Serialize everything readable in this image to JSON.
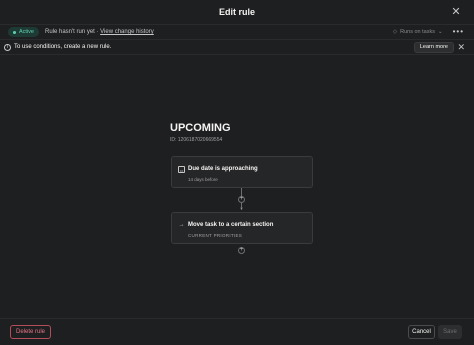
{
  "header": {
    "title": "Edit rule",
    "close_icon": "close-icon"
  },
  "status": {
    "badge": "Active",
    "run_text": "Rule hasn't run yet · ",
    "history_link": "View change history",
    "runs_on": "Runs on tasks",
    "more": "•••"
  },
  "info": {
    "message": "To use conditions, create a new rule.",
    "learn_more": "Learn more"
  },
  "rule": {
    "title": "UPCOMING",
    "id": "ID: 1206187020669554"
  },
  "trigger": {
    "title": "Due date is approaching",
    "subtitle": "14 days before",
    "icon": "calendar-icon"
  },
  "action": {
    "title": "Move task to a certain section",
    "subtitle": "CURRENT PRIORITIES",
    "icon": "arrow-right-icon"
  },
  "footer": {
    "delete_label": "Delete rule",
    "cancel_label": "Cancel",
    "save_label": "Save"
  },
  "colors": {
    "background": "#1e1f21",
    "active_badge": "#5fd3b0",
    "danger": "#e57587"
  }
}
